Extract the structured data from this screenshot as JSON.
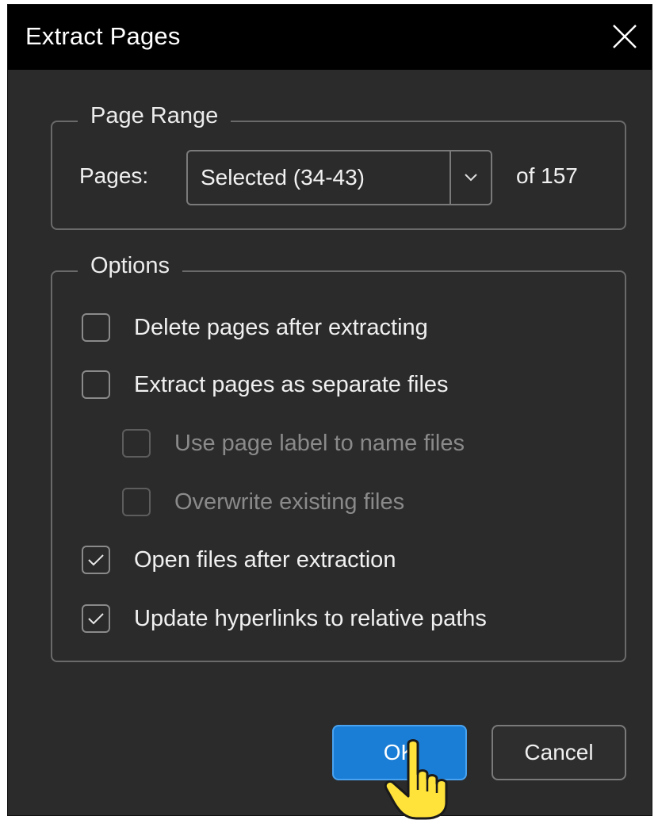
{
  "dialog": {
    "title": "Extract Pages",
    "close_icon": "close-icon"
  },
  "page_range": {
    "legend": "Page Range",
    "pages_label": "Pages:",
    "selected_value": "Selected (34-43)",
    "of_total": "of 157"
  },
  "options": {
    "legend": "Options",
    "items": [
      {
        "label": "Delete pages after extracting",
        "checked": false,
        "enabled": true
      },
      {
        "label": "Extract pages as separate files",
        "checked": false,
        "enabled": true
      },
      {
        "label": "Use page label to name files",
        "checked": false,
        "enabled": false
      },
      {
        "label": "Overwrite existing files",
        "checked": false,
        "enabled": false
      },
      {
        "label": "Open files after extraction",
        "checked": true,
        "enabled": true
      },
      {
        "label": "Update hyperlinks to relative paths",
        "checked": true,
        "enabled": true
      }
    ]
  },
  "buttons": {
    "ok_label": "OK",
    "cancel_label": "Cancel"
  },
  "colors": {
    "accent": "#1a7ed6",
    "background": "#2b2b2b",
    "titlebar": "#000000"
  }
}
